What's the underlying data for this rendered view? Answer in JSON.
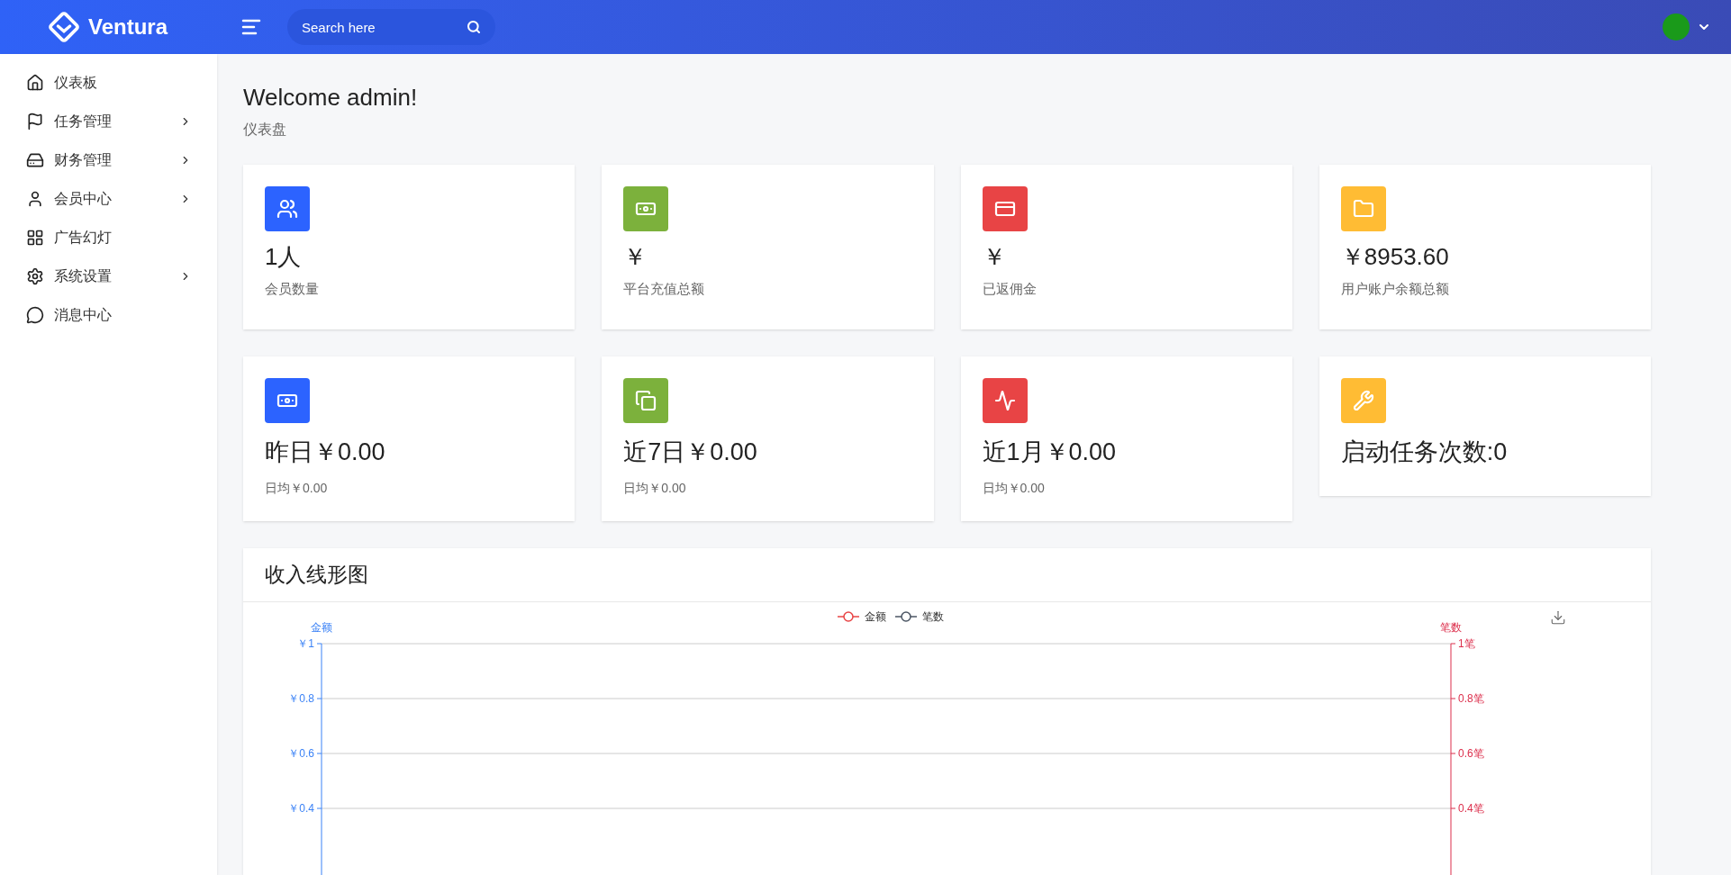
{
  "header": {
    "brand": "Ventura",
    "search": {
      "placeholder": "Search here"
    }
  },
  "sidebar": {
    "items": [
      {
        "label": "仪表板",
        "has_submenu": false
      },
      {
        "label": "任务管理",
        "has_submenu": true
      },
      {
        "label": "财务管理",
        "has_submenu": true
      },
      {
        "label": "会员中心",
        "has_submenu": true
      },
      {
        "label": "广告幻灯",
        "has_submenu": false
      },
      {
        "label": "系统设置",
        "has_submenu": true
      },
      {
        "label": "消息中心",
        "has_submenu": false
      }
    ]
  },
  "page": {
    "title": "Welcome admin!",
    "subtitle": "仪表盘"
  },
  "stats": [
    {
      "value": "1人",
      "label": "会员数量",
      "color": "#2c63ff"
    },
    {
      "value": "￥",
      "label": "平台充值总额",
      "color": "#7cb13c"
    },
    {
      "value": "￥",
      "label": "已返佣金",
      "color": "#e84445"
    },
    {
      "value": "￥8953.60",
      "label": "用户账户余额总额",
      "color": "#ffbc34"
    }
  ],
  "periods": [
    {
      "value": "昨日￥0.00",
      "label": "日均￥0.00",
      "color": "#2c63ff"
    },
    {
      "value": "近7日￥0.00",
      "label": "日均￥0.00",
      "color": "#7cb13c"
    },
    {
      "value": "近1月￥0.00",
      "label": "日均￥0.00",
      "color": "#e84445"
    },
    {
      "value": "启动任务次数:0",
      "color": "#ffbc34"
    }
  ],
  "income_chart": {
    "title": "收入线形图",
    "chart_data": {
      "type": "line",
      "ylabel": "金额",
      "y2label": "笔数",
      "series": [
        {
          "name": "金额",
          "color": "#e84445"
        },
        {
          "name": "笔数",
          "color": "#4b5563"
        }
      ],
      "ylim": [
        0,
        1
      ],
      "y2lim": [
        0,
        1
      ],
      "grid": true,
      "yticks": [
        {
          "value": 1,
          "label": "￥1"
        },
        {
          "value": 0.8,
          "label": "￥0.8"
        },
        {
          "value": 0.6,
          "label": "￥0.6"
        },
        {
          "value": 0.4,
          "label": "￥0.4"
        }
      ],
      "y2ticks": [
        {
          "value": 1,
          "label": "1笔"
        },
        {
          "value": 0.8,
          "label": "0.8笔"
        },
        {
          "value": 0.6,
          "label": "0.6笔"
        },
        {
          "value": 0.4,
          "label": "0.4笔"
        }
      ]
    }
  }
}
